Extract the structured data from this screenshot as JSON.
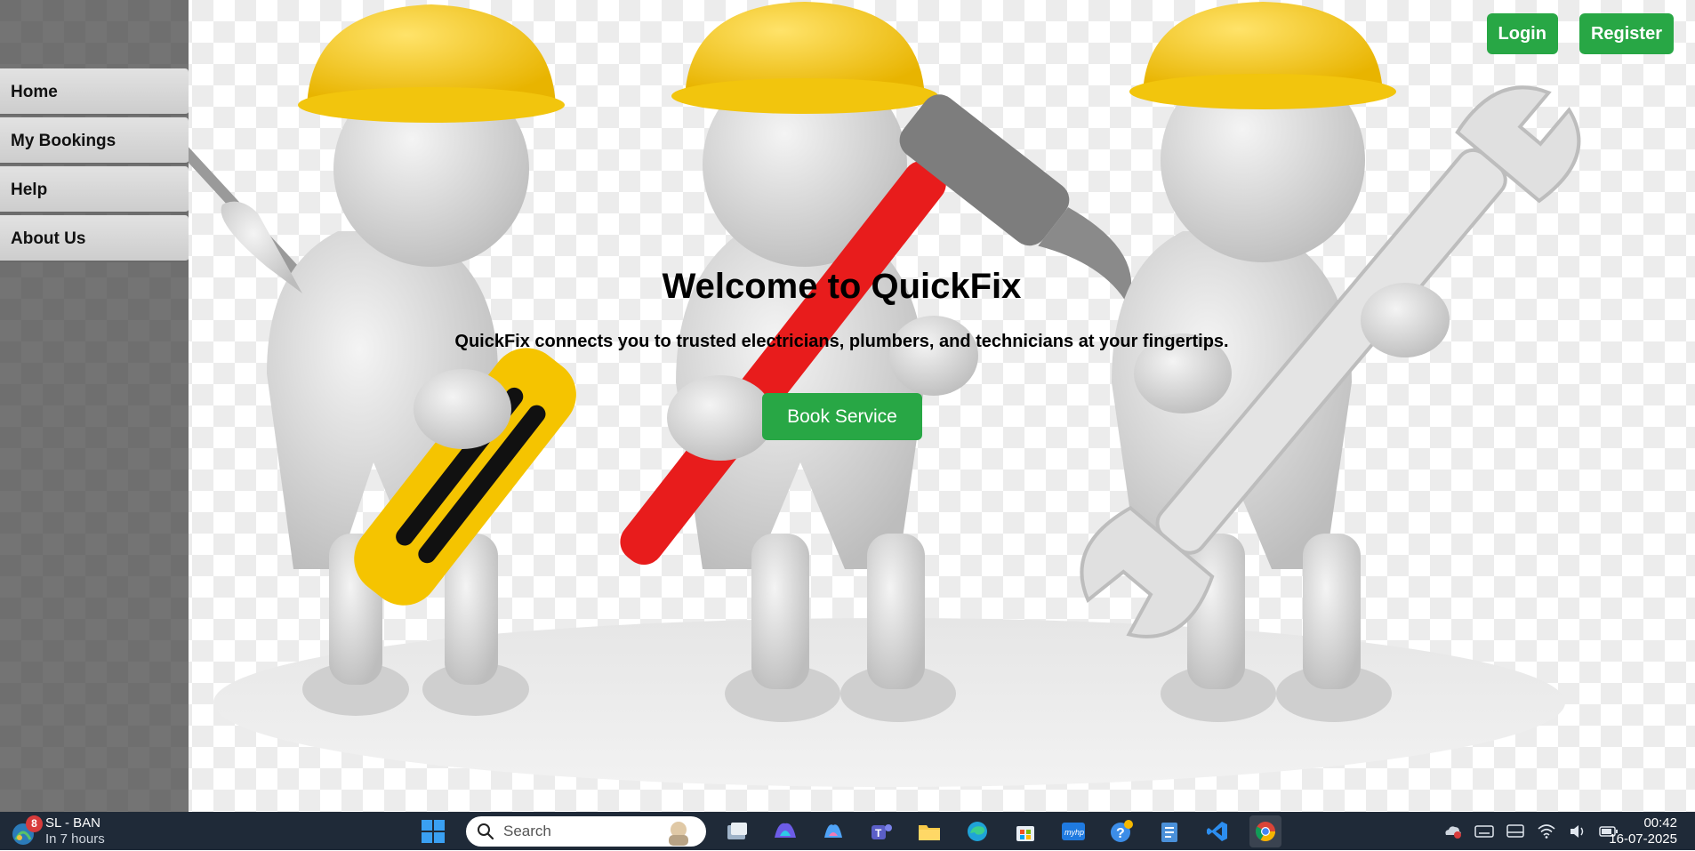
{
  "hero": {
    "title": "Welcome to QuickFix",
    "subtitle": "QuickFix connects you to trusted electricians, plumbers, and technicians at your fingertips.",
    "book_label": "Book Service"
  },
  "nav": {
    "items": [
      {
        "label": "Home"
      },
      {
        "label": "My Bookings"
      },
      {
        "label": "Help"
      },
      {
        "label": "About Us"
      }
    ]
  },
  "auth": {
    "login_label": "Login",
    "register_label": "Register"
  },
  "taskbar": {
    "weather": {
      "badge": "8",
      "title": "SL - BAN",
      "subtitle": "In 7 hours"
    },
    "search": {
      "placeholder": "Search"
    },
    "apps": [
      {
        "icon": "windows-start-icon"
      },
      {
        "icon": "task-view-icon"
      },
      {
        "icon": "m365-copilot-icon"
      },
      {
        "icon": "copilot-icon"
      },
      {
        "icon": "teams-icon"
      },
      {
        "icon": "file-explorer-icon"
      },
      {
        "icon": "edge-icon"
      },
      {
        "icon": "microsoft-store-icon"
      },
      {
        "icon": "myhp-icon"
      },
      {
        "icon": "get-help-icon"
      },
      {
        "icon": "notepad-icon"
      },
      {
        "icon": "vscode-icon"
      },
      {
        "icon": "chrome-icon"
      }
    ],
    "clock": {
      "time": "00:42",
      "date": "16-07-2025"
    }
  },
  "colors": {
    "accent_green": "#28a745",
    "taskbar_bg": "#1f2a38",
    "sidebar_bg": "#5a5a5a",
    "nav_item_bg": "#d6d6d6"
  }
}
